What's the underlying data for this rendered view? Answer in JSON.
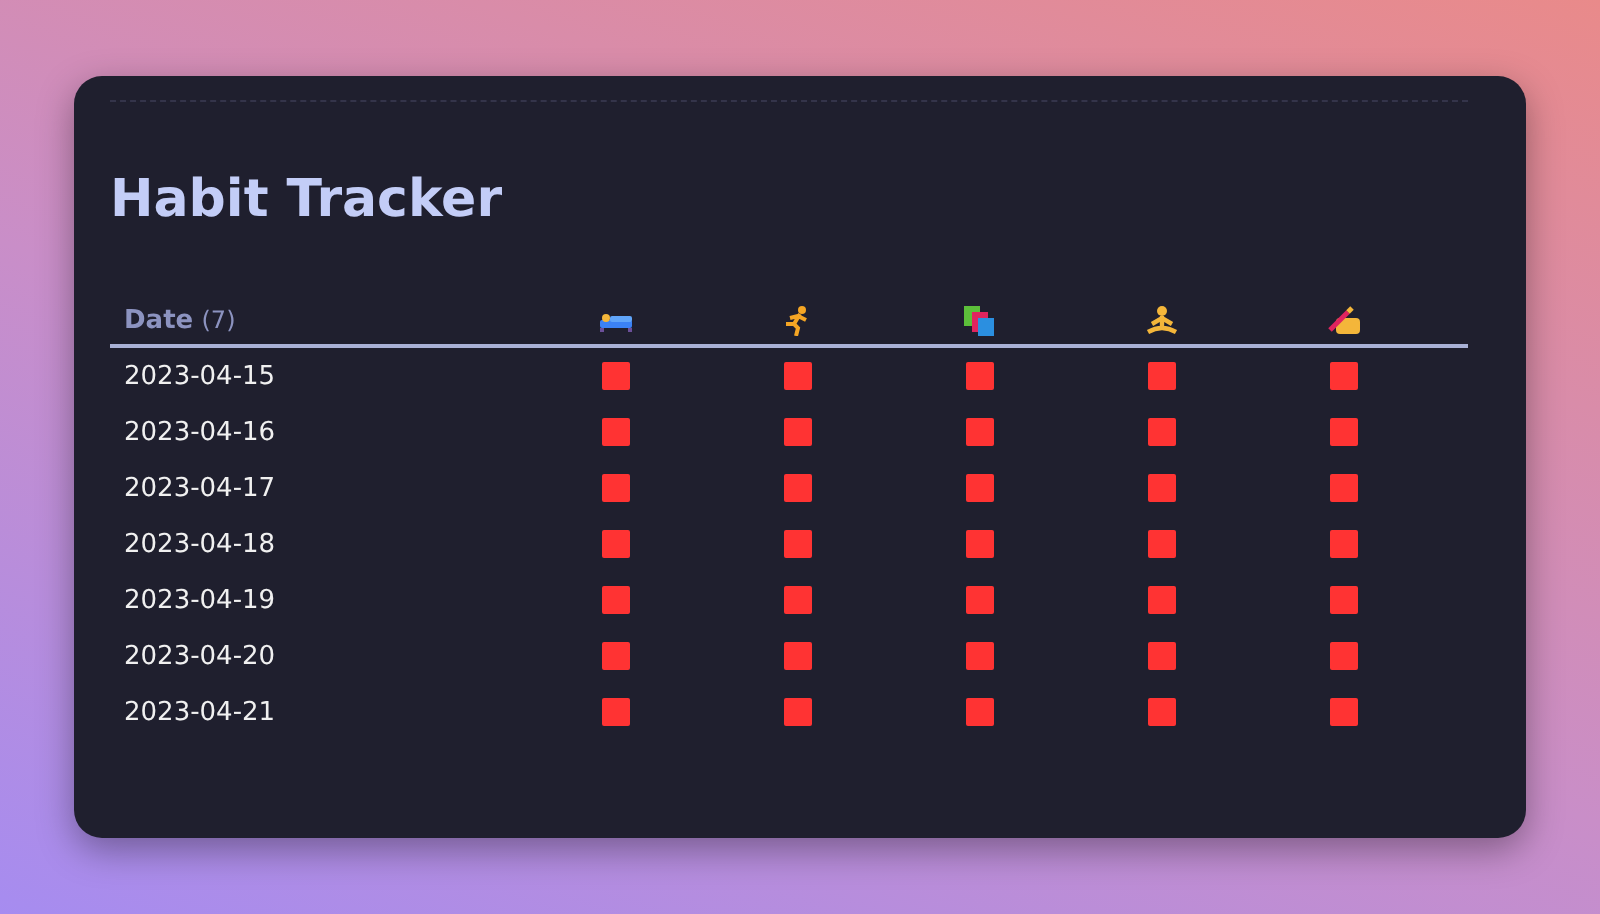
{
  "title": "Habit Tracker",
  "table": {
    "date_header": "Date",
    "count": "(7)",
    "habits": [
      {
        "kind": "sleep"
      },
      {
        "kind": "run"
      },
      {
        "kind": "books"
      },
      {
        "kind": "meditate"
      },
      {
        "kind": "write"
      }
    ],
    "rows": [
      {
        "date": "2023-04-15",
        "done": [
          false,
          false,
          false,
          false,
          false
        ]
      },
      {
        "date": "2023-04-16",
        "done": [
          false,
          false,
          false,
          false,
          false
        ]
      },
      {
        "date": "2023-04-17",
        "done": [
          false,
          false,
          false,
          false,
          false
        ]
      },
      {
        "date": "2023-04-18",
        "done": [
          false,
          false,
          false,
          false,
          false
        ]
      },
      {
        "date": "2023-04-19",
        "done": [
          false,
          false,
          false,
          false,
          false
        ]
      },
      {
        "date": "2023-04-20",
        "done": [
          false,
          false,
          false,
          false,
          false
        ]
      },
      {
        "date": "2023-04-21",
        "done": [
          false,
          false,
          false,
          false,
          false
        ]
      }
    ]
  }
}
